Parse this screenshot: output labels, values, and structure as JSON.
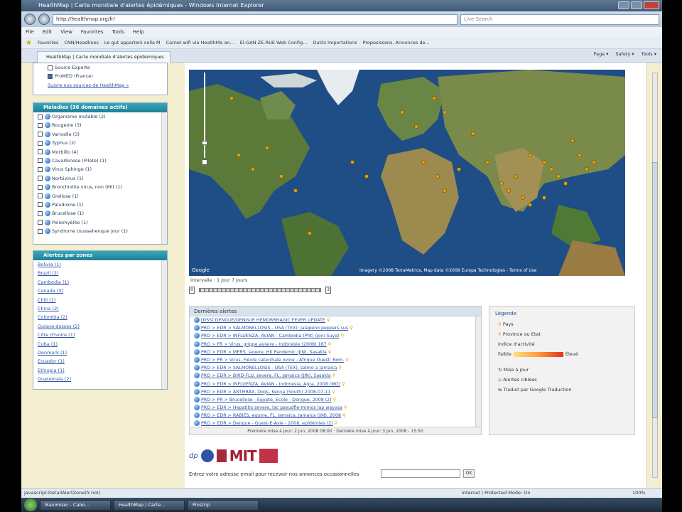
{
  "window": {
    "title": "HealthMap | Carte mondiale d'alertes épidémiques - Windows Internet Explorer"
  },
  "browser": {
    "url": "http://healthmap.org/fr/",
    "search_placeholder": "Live Search",
    "menu": [
      "File",
      "Edit",
      "View",
      "Favorites",
      "Tools",
      "Help"
    ],
    "favorites_label": "Favorites",
    "favorites": [
      "CNN/Headlines",
      "Le gut apparteni cella M",
      "Carnet wifi via HealthMa an...",
      "El-GAN ZE-RUE Web Config...",
      "Outils Importations",
      "Proposissons, Annonces de..."
    ],
    "tab_label": "HealthMap | Carte mondiale d'alertes épidémiques",
    "tab_tools": [
      "Page ▾",
      "Safety ▾",
      "Tools ▾"
    ]
  },
  "left_panel": {
    "top_box": {
      "items": [
        {
          "label": "Source Experte",
          "checked": false
        },
        {
          "label": "ProMED (France)",
          "checked": true
        }
      ],
      "more_link": "Suivre nos sources de HealthMap »"
    },
    "diseases_box": {
      "header": "Maladies (36 domaines actifs)",
      "items": [
        "Organisme mutable (2)",
        "Rougeole (3)",
        "Varicelle (3)",
        "Typhus (2)",
        "Morbillo (4)",
        "Cavarbinose (Pilote) (1)",
        "Virus Sphinge (1)",
        "Norbivirus (1)",
        "Bronchiolite virus, non (MI) (1)",
        "Grellose (1)",
        "Paludisme (1)",
        "Brucellose (1)",
        "Poliomyélite (1)",
        "Syndrome toussehenque jour (1)"
      ]
    },
    "locations_box": {
      "header": "Alertes par zones",
      "items": [
        "Bolivia (1)",
        "Brazil (2)",
        "Cambodia (1)",
        "Canada (3)",
        "Chili (1)",
        "China (2)",
        "Colombia (2)",
        "Guiana-dosses (2)",
        "Côte d'Ivoire (1)",
        "Cuba (1)",
        "Denmark (1)",
        "Ecuador (1)",
        "Ethiopia (1)",
        "Guatemala (2)"
      ]
    }
  },
  "map": {
    "attribution": "Imagery ©2008 TerraMetrics, Map data ©2008 Europa Technologies - Terms of Use",
    "provider": "Google"
  },
  "timeline": {
    "label": "Intervalle : 1 Jour  7 Jours",
    "start_value": "0",
    "end_value": "3"
  },
  "alerts": {
    "header": "Dernières alertes",
    "items": [
      "[DSS] DENGUE/DENGUE HEMORRHAGIC FEVER UPDATE",
      "PRO > EDR > SALMONELLOSIS - USA (TEX): Jalapeno peppers sus",
      "PRO > EDR > INFLUENZA, AVIAN - Cambodia (Pht) (Joni Suya)",
      "PRO > FR > Virus, grippe aviaire - Indonésie (2008) 167",
      "PRO > EDR > MERS, severe, HK Pandemic (JIN), Sasakla",
      "PRO > PR > Virus, Fièvre caterrhale ovine - Afrique Ouest: Rom.",
      "PRO > EDR > SALMONELLOSIS - USA (TEX), salmo a Jamaica",
      "PRO > EDR > BIRD-FLU, severe, FL, Jamaica (JIN), Sasakla",
      "PRO > EDR > INFLUENZA, AVIAN - Indonesia, Agra, 2008 (MO)",
      "PRO > EDR > ANTHRAX, Dogs, Kenya (South) 2008-07-11",
      "PRO > PR > Brucellose - Egypte, Ecole - Dengue, 2008 (2)",
      "PRO > EDR > Hepatitis severe, lac pseudfle-mimos lap wayvsa",
      "PRO > EDR > RABIES, equine, FL, Jamaica, Jamaica (JIN), 2008",
      "PRO > EDR > Dengue - Ouest-E-Asie - 2008, epidémies (2)"
    ],
    "footer": "Première mise à jour: 2 Jun, 2008 08:00 · Dernière mise à jour: 3 Jun, 2008 - 15:50"
  },
  "legend": {
    "header": "Légende",
    "items": [
      "Pays",
      "Province ou Etat"
    ],
    "heat_label": "Indice d'activité",
    "heat_low": "Faible",
    "heat_high": "Élevé",
    "links": [
      "Mise à jour",
      "Alertes ciblées",
      "Traduit par Google Traduction"
    ]
  },
  "footer": {
    "logo_labels": [
      "dp",
      "MIT"
    ],
    "subscribe_text": "Entrez votre adresse email pour recevoir nos annonces occasionnelles",
    "subscribe_button": "OK"
  },
  "status": {
    "left": "javascript:DetailAlertZone(fr.not)",
    "zone": "Internet | Protected Mode: On",
    "zoom": "100%"
  },
  "taskbar": {
    "buttons": [
      "Maximiser - Cabo...",
      "HealthMap | Carte...",
      "Pinstrip"
    ]
  },
  "colors": {
    "box_header": "#1f7f96",
    "left_bg": "#f3eed0",
    "link": "#2d55a6",
    "pin": "#e6a000"
  }
}
